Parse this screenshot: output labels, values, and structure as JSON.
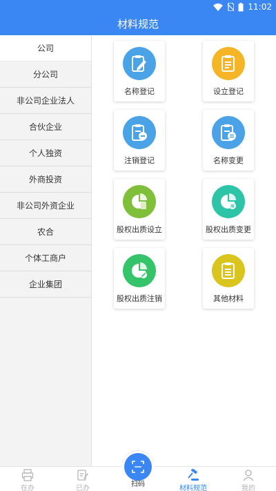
{
  "status": {
    "time": "11:02"
  },
  "header": {
    "title": "材料规范"
  },
  "sidebar": {
    "items": [
      {
        "label": "公司",
        "active": true
      },
      {
        "label": "分公司"
      },
      {
        "label": "非公司企业法人"
      },
      {
        "label": "合伙企业"
      },
      {
        "label": "个人独资"
      },
      {
        "label": "外商投资"
      },
      {
        "label": "非公司外资企业"
      },
      {
        "label": "农合"
      },
      {
        "label": "个体工商户"
      },
      {
        "label": "企业集团"
      }
    ]
  },
  "cards": [
    {
      "label": "名称登记",
      "color": "#4aa3e6",
      "icon": "clipboard-pen-icon"
    },
    {
      "label": "设立登记",
      "color": "#f5b526",
      "icon": "clipboard-list-icon"
    },
    {
      "label": "注销登记",
      "color": "#4aa3e6",
      "icon": "clipboard-cancel-icon"
    },
    {
      "label": "名称变更",
      "color": "#4aa3e6",
      "icon": "clipboard-change-icon"
    },
    {
      "label": "股权出质设立",
      "color": "#7fbf3a",
      "icon": "pie-chart-icon"
    },
    {
      "label": "股权出质变更",
      "color": "#2ec4a8",
      "icon": "pie-chart-change-icon"
    },
    {
      "label": "股权出质注销",
      "color": "#35c46a",
      "icon": "pie-chart-cancel-icon"
    },
    {
      "label": "其他材料",
      "color": "#d9c51d",
      "icon": "clipboard-other-icon"
    }
  ],
  "tabbar": {
    "tabs": [
      {
        "label": "在办",
        "icon": "printer-icon"
      },
      {
        "label": "已办",
        "icon": "edit-doc-icon"
      },
      {
        "label": "扫码",
        "icon": "scan-icon"
      },
      {
        "label": "材料规范",
        "icon": "gavel-icon",
        "active": true
      },
      {
        "label": "我的",
        "icon": "user-icon"
      }
    ]
  },
  "colors": {
    "primary": "#3a86f2",
    "sidebar_bg": "#f3f3f3"
  }
}
